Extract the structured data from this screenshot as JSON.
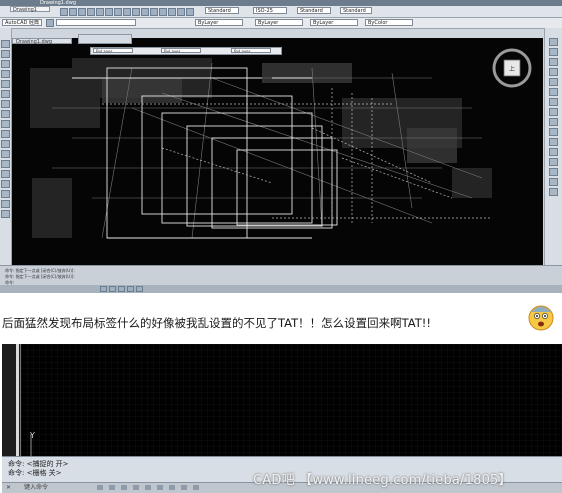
{
  "top_screenshot": {
    "window_title": "Drawing1.dwg",
    "doc_tab": "Drawing1",
    "drawing_tab": "Drawing1.dwg",
    "workspace": "AutoCAD 经典",
    "style_dropdowns": [
      "Standard",
      "ISO-25",
      "Standard",
      "Standard"
    ],
    "layer_dropdowns": [
      "ByLayer",
      "ByLayer",
      "ByLayer",
      "ByColor"
    ],
    "viewcube_label": "上",
    "command_lines": [
      "命令: 指定下一点或 [闭合(C)/放弃(U)]:",
      "命令: 指定下一点或 [闭合(C)/放弃(U)]:",
      "命令:"
    ]
  },
  "post": {
    "text": "后面猛然发现布局标签什么的好像被我乱设置的不见了TAT！！怎么设置回来啊TAT!!"
  },
  "bottom_screenshot": {
    "axis_label": "Y",
    "command_rows": [
      "命令:  <捕捉的 开>",
      "命令:  <栅格 关>"
    ],
    "command_prompt": "键入命令",
    "watermark": "CAD吧 【www.lineeg.com/tieba/1805】"
  },
  "colors": {
    "canvas": "#050505",
    "line_white": "#e6e6e6",
    "line_grey": "#8a8a8a",
    "toolbar": "#dfe4ea"
  },
  "icons": [
    "shocked-face-emoji-icon",
    "viewcube-compass-icon"
  ]
}
